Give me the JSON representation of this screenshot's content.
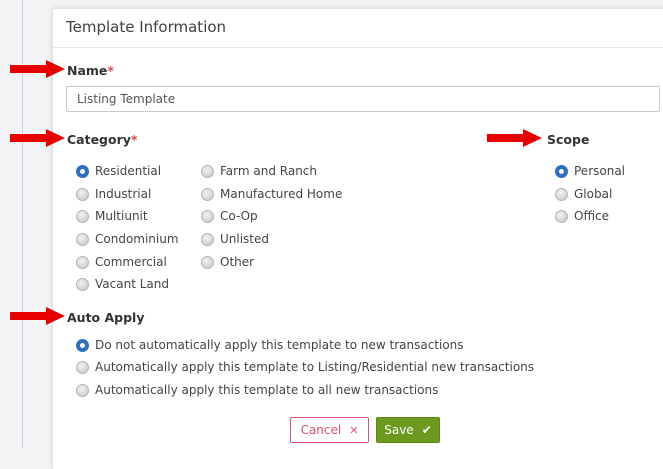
{
  "panel": {
    "title": "Template Information"
  },
  "name_field": {
    "label": "Name",
    "required_mark": "*",
    "value": "Listing Template"
  },
  "category": {
    "label": "Category",
    "required_mark": "*",
    "options": [
      "Residential",
      "Industrial",
      "Multiunit",
      "Condominium",
      "Commercial",
      "Vacant Land",
      "Farm and Ranch",
      "Manufactured Home",
      "Co-Op",
      "Unlisted",
      "Other"
    ],
    "selected": "Residential"
  },
  "scope": {
    "label": "Scope",
    "options": [
      "Personal",
      "Global",
      "Office"
    ],
    "selected": "Personal"
  },
  "auto_apply": {
    "label": "Auto Apply",
    "options": [
      "Do not automatically apply this template to new transactions",
      "Automatically apply this template to Listing/Residential new transactions",
      "Automatically apply this template to all new transactions"
    ],
    "selected": "Do not automatically apply this template to new transactions"
  },
  "buttons": {
    "cancel": "Cancel",
    "save": "Save"
  },
  "colors": {
    "accent": "#2f6fbe",
    "required": "#e34b4b",
    "save": "#6b9a1e",
    "cancel": "#d9536f",
    "arrow": "#e60000"
  },
  "icons": {
    "cancel_icon": "x-icon",
    "save_icon": "check-icon",
    "arrow_icon": "arrow-right-icon"
  }
}
